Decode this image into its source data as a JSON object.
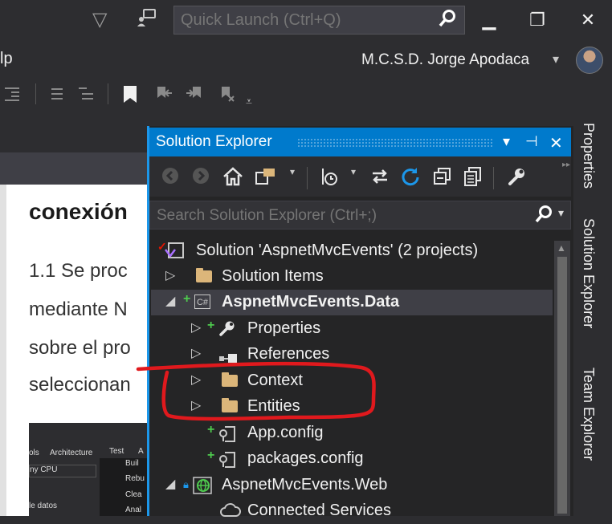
{
  "titlebar": {
    "quick_launch_placeholder": "Quick Launch (Ctrl+Q)",
    "minimize": "▁",
    "restore": "❐",
    "close": "✕"
  },
  "menubar": {
    "partial_item": "lp",
    "user_name": "M.C.S.D. Jorge Apodaca",
    "user_dropdown": "▾"
  },
  "document": {
    "heading": "conexión",
    "lines": [
      "1.1 Se proc",
      "mediante N",
      "sobre el pro",
      "seleccionan"
    ],
    "screenshot_texts": [
      "ols",
      "Architecture",
      "Test",
      "A",
      "ny CPU",
      "Buil",
      "Rebu",
      "Clea",
      "Anal",
      "le datos"
    ]
  },
  "solution_explorer": {
    "title": "Solution Explorer",
    "search_placeholder": "Search Solution Explorer (Ctrl+;)",
    "title_buttons": [
      "▾",
      "⊣",
      "✕"
    ],
    "items": [
      {
        "label": "Solution 'AspnetMvcEvents' (2 projects)",
        "kind": "solution",
        "bold": false
      },
      {
        "label": "Solution Items",
        "kind": "folder",
        "bold": false
      },
      {
        "label": "AspnetMvcEvents.Data",
        "kind": "csproject",
        "bold": true
      },
      {
        "label": "Properties",
        "kind": "properties",
        "bold": false
      },
      {
        "label": "References",
        "kind": "references",
        "bold": false
      },
      {
        "label": "Context",
        "kind": "folder",
        "bold": false
      },
      {
        "label": "Entities",
        "kind": "folder",
        "bold": false
      },
      {
        "label": "App.config",
        "kind": "config",
        "bold": false
      },
      {
        "label": "packages.config",
        "kind": "config",
        "bold": false
      },
      {
        "label": "AspnetMvcEvents.Web",
        "kind": "webproject",
        "bold": false
      },
      {
        "label": "Connected Services",
        "kind": "connected",
        "bold": false
      }
    ]
  },
  "right_tabs": [
    "Properties",
    "Solution Explorer",
    "Team Explorer"
  ],
  "colors": {
    "accent": "#007acc",
    "background": "#2d2d30",
    "annotation": "#e0191d"
  }
}
